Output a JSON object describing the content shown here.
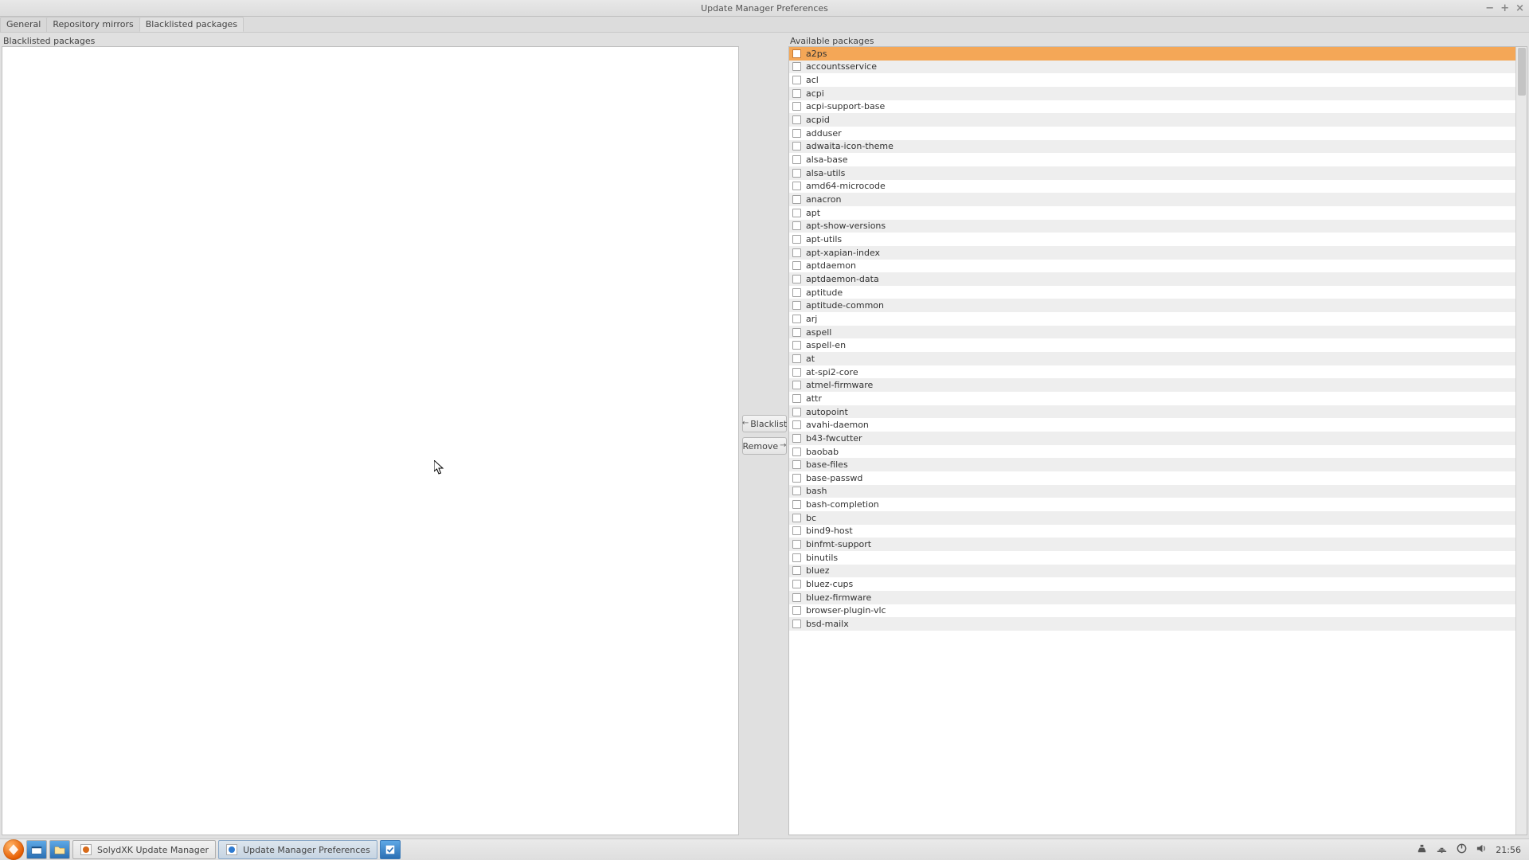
{
  "window": {
    "title": "Update Manager Preferences"
  },
  "tabs": [
    {
      "label": "General",
      "active": false
    },
    {
      "label": "Repository mirrors",
      "active": false
    },
    {
      "label": "Blacklisted packages",
      "active": true
    }
  ],
  "columns": {
    "left_header": "Blacklisted packages",
    "right_header": "Available packages"
  },
  "buttons": {
    "blacklist": "Blacklist",
    "remove": "Remove"
  },
  "available_packages": [
    {
      "name": "a2ps",
      "selected": true
    },
    {
      "name": "accountsservice"
    },
    {
      "name": "acl"
    },
    {
      "name": "acpi"
    },
    {
      "name": "acpi-support-base"
    },
    {
      "name": "acpid"
    },
    {
      "name": "adduser"
    },
    {
      "name": "adwaita-icon-theme"
    },
    {
      "name": "alsa-base"
    },
    {
      "name": "alsa-utils"
    },
    {
      "name": "amd64-microcode"
    },
    {
      "name": "anacron"
    },
    {
      "name": "apt"
    },
    {
      "name": "apt-show-versions"
    },
    {
      "name": "apt-utils"
    },
    {
      "name": "apt-xapian-index"
    },
    {
      "name": "aptdaemon"
    },
    {
      "name": "aptdaemon-data"
    },
    {
      "name": "aptitude"
    },
    {
      "name": "aptitude-common"
    },
    {
      "name": "arj"
    },
    {
      "name": "aspell"
    },
    {
      "name": "aspell-en"
    },
    {
      "name": "at"
    },
    {
      "name": "at-spi2-core"
    },
    {
      "name": "atmel-firmware"
    },
    {
      "name": "attr"
    },
    {
      "name": "autopoint"
    },
    {
      "name": "avahi-daemon"
    },
    {
      "name": "b43-fwcutter"
    },
    {
      "name": "baobab"
    },
    {
      "name": "base-files"
    },
    {
      "name": "base-passwd"
    },
    {
      "name": "bash"
    },
    {
      "name": "bash-completion"
    },
    {
      "name": "bc"
    },
    {
      "name": "bind9-host"
    },
    {
      "name": "binfmt-support"
    },
    {
      "name": "binutils"
    },
    {
      "name": "bluez"
    },
    {
      "name": "bluez-cups"
    },
    {
      "name": "bluez-firmware"
    },
    {
      "name": "browser-plugin-vlc"
    },
    {
      "name": "bsd-mailx"
    }
  ],
  "taskbar": {
    "items": [
      {
        "label": "SolydXK Update Manager",
        "active": false,
        "icon_color": "#d86b1a"
      },
      {
        "label": "Update Manager Preferences",
        "active": true,
        "icon_color": "#2e7bd1"
      }
    ],
    "clock": "21:56"
  }
}
